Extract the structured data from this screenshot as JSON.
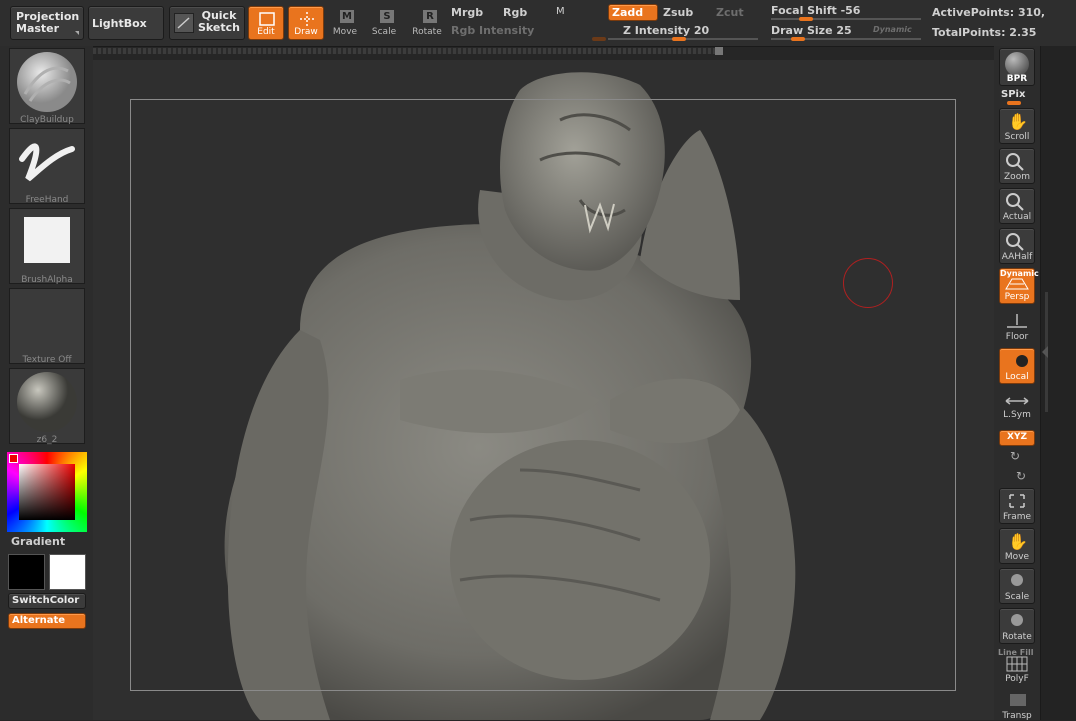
{
  "topbar": {
    "projection_master": "Projection Master",
    "lightbox": "LightBox",
    "quick_sketch": "Quick Sketch",
    "edit": "Edit",
    "draw": "Draw",
    "move": "Move",
    "scale": "Scale",
    "rotate": "Rotate",
    "mrgb": "Mrgb",
    "rgb": "Rgb",
    "m": "M",
    "rgb_intensity": "Rgb Intensity",
    "zadd": "Zadd",
    "zsub": "Zsub",
    "zcut": "Zcut",
    "z_intensity": "Z Intensity 20",
    "focal_shift": "Focal Shift -56",
    "draw_size": "Draw Size 25",
    "dynamic": "Dynamic",
    "active_points": "ActivePoints: 310,",
    "total_points": "TotalPoints: 2.35"
  },
  "left": {
    "brush": "ClayBuildup",
    "stroke": "FreeHand",
    "alpha": "BrushAlpha",
    "texture": "Texture Off",
    "material": "z6_2",
    "gradient": "Gradient",
    "switchcolor": "SwitchColor",
    "alternate": "Alternate"
  },
  "right": {
    "bpr": "BPR",
    "spix": "SPix",
    "scroll": "Scroll",
    "zoom": "Zoom",
    "actual": "Actual",
    "aahalf": "AAHalf",
    "dynamic": "Dynamic",
    "persp": "Persp",
    "floor": "Floor",
    "local": "Local",
    "lsym": "L.Sym",
    "xyz": "XYZ",
    "frame": "Frame",
    "move": "Move",
    "scale": "Scale",
    "rotate": "Rotate",
    "line_fill": "Line Fill",
    "polyf": "PolyF",
    "transp": "Transp"
  },
  "colors": {
    "accent": "#e9741e",
    "panel": "#2c2c2c",
    "canvas": "#2f2f2f",
    "cursor": "#b02020"
  }
}
